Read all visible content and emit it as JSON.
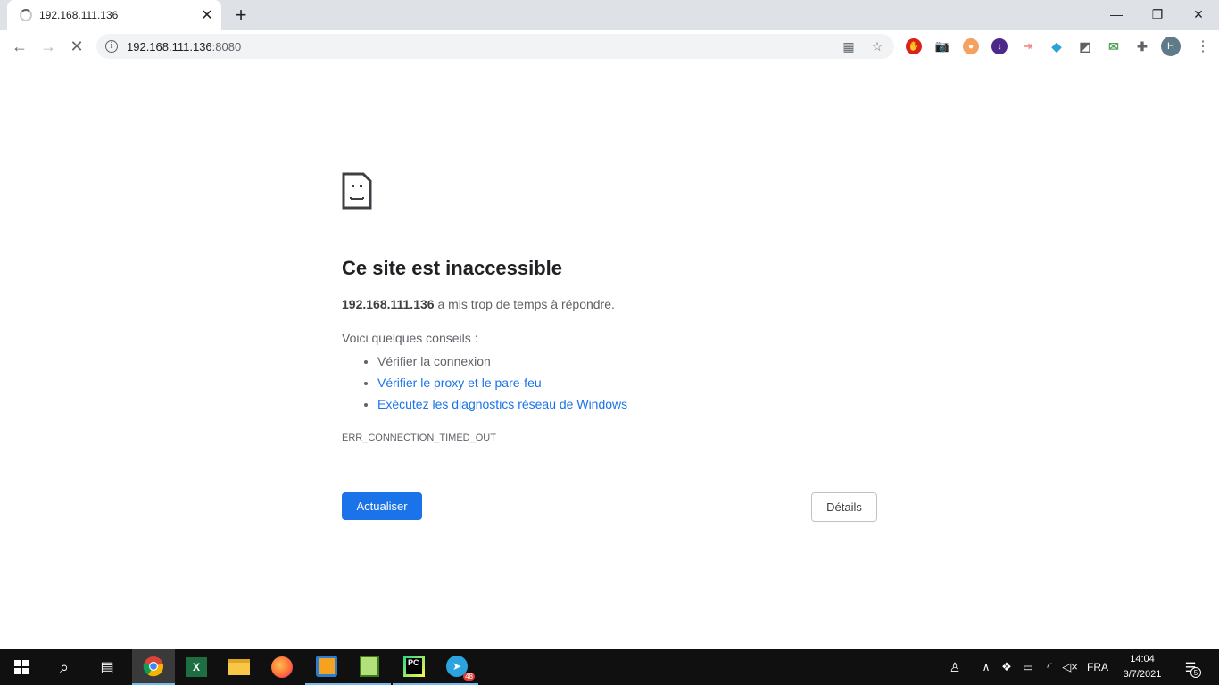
{
  "tab": {
    "title": "192.168.111.136"
  },
  "address": {
    "host": "192.168.111.136",
    "port": ":8080"
  },
  "error": {
    "title": "Ce site est inaccessible",
    "host": "192.168.111.136",
    "message": " a mis trop de temps à répondre.",
    "tips_heading": "Voici quelques conseils :",
    "tips": [
      {
        "text": "Vérifier la connexion",
        "link": false
      },
      {
        "text": "Vérifier le proxy et le pare-feu",
        "link": true
      },
      {
        "text": "Exécutez les diagnostics réseau de Windows",
        "link": true
      }
    ],
    "code": "ERR_CONNECTION_TIMED_OUT"
  },
  "buttons": {
    "reload": "Actualiser",
    "details": "Détails"
  },
  "profile": {
    "initial": "H"
  },
  "taskbar": {
    "language": "FRA",
    "time": "14:04",
    "date": "3/7/2021",
    "telegram_badge": "48",
    "notif_count": "5"
  },
  "colors": {
    "accent": "#1a73e8",
    "tabstrip": "#dee1e6",
    "taskbar": "#101010"
  }
}
